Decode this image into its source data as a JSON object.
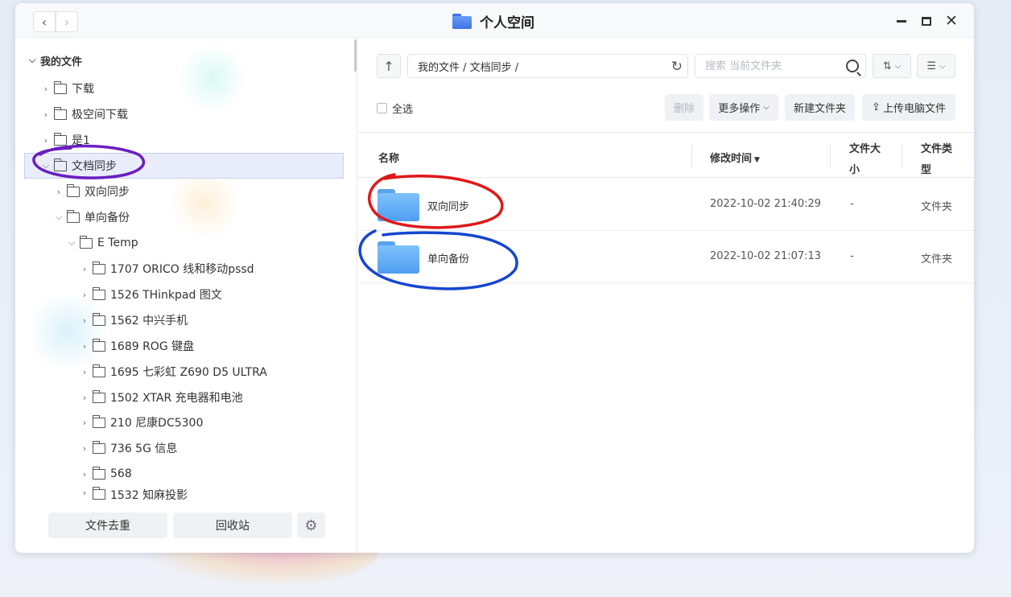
{
  "window": {
    "title": "个人空间"
  },
  "sidebar": {
    "root_label": "我的文件",
    "items": [
      {
        "label": "下载"
      },
      {
        "label": "极空间下载"
      },
      {
        "label": "是1"
      },
      {
        "label": "文档同步"
      },
      {
        "label": "双向同步"
      },
      {
        "label": "单向备份"
      },
      {
        "label": "E Temp"
      },
      {
        "label": "1707 ORICO 线和移动pssd"
      },
      {
        "label": "1526 THinkpad 图文"
      },
      {
        "label": "1562 中兴手机"
      },
      {
        "label": "1689 ROG 键盘"
      },
      {
        "label": "1695 七彩虹 Z690 D5 ULTRA"
      },
      {
        "label": "1502 XTAR 充电器和电池"
      },
      {
        "label": "210 尼康DC5300"
      },
      {
        "label": "736 5G 信息"
      },
      {
        "label": "568"
      },
      {
        "label": "1532 知麻投影"
      }
    ],
    "dedup_label": "文件去重",
    "recycle_label": "回收站"
  },
  "toolbar": {
    "path": "我的文件 / 文档同步 /",
    "search_placeholder": "搜索 当前文件夹"
  },
  "actions": {
    "select_all": "全选",
    "delete": "删除",
    "more": "更多操作",
    "new_folder": "新建文件夹",
    "upload": "上传电脑文件"
  },
  "columns": {
    "name": "名称",
    "modified": "修改时间",
    "size": "文件大小",
    "type": "文件类型"
  },
  "files": [
    {
      "name": "双向同步",
      "modified": "2022-10-02 21:40:29",
      "size": "-",
      "type": "文件夹"
    },
    {
      "name": "单向备份",
      "modified": "2022-10-02 21:07:13",
      "size": "-",
      "type": "文件夹"
    }
  ],
  "icons": {
    "back": "chevron-left-icon",
    "forward": "chevron-right-icon",
    "up": "arrow-up-icon",
    "refresh": "refresh-icon",
    "search": "search-icon",
    "settings": "gear-icon"
  },
  "colors": {
    "accent": "#3e73e6",
    "folder": "#4f9ef0",
    "annotation_purple": "#6a1fc0",
    "annotation_red": "#e01818",
    "annotation_blue": "#1546d0"
  }
}
